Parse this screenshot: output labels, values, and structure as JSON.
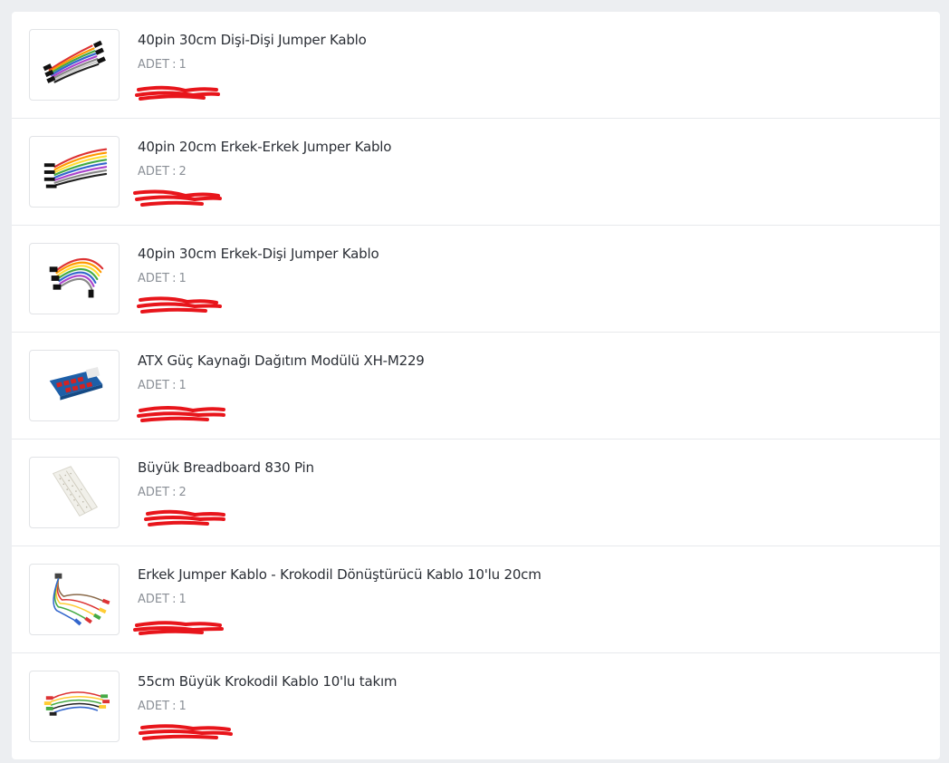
{
  "cart": {
    "qty_label": "ADET",
    "qty_separator": ":",
    "items": [
      {
        "name": "40pin 30cm Dişi-Dişi Jumper Kablo",
        "qty": "1",
        "image_icon": "jumper-wires-female-female-icon"
      },
      {
        "name": "40pin 20cm Erkek-Erkek Jumper Kablo",
        "qty": "2",
        "image_icon": "jumper-wires-male-male-icon"
      },
      {
        "name": "40pin 30cm Erkek-Dişi Jumper Kablo",
        "qty": "1",
        "image_icon": "jumper-wires-male-female-icon"
      },
      {
        "name": "ATX Güç Kaynağı Dağıtım Modülü XH-M229",
        "qty": "1",
        "image_icon": "atx-power-module-icon"
      },
      {
        "name": "Büyük Breadboard 830 Pin",
        "qty": "2",
        "image_icon": "breadboard-icon"
      },
      {
        "name": "Erkek Jumper Kablo - Krokodil Dönüştürücü Kablo 10'lu 20cm",
        "qty": "1",
        "image_icon": "crocodile-adapter-cable-icon"
      },
      {
        "name": "55cm Büyük Krokodil Kablo 10'lu takım",
        "qty": "1",
        "image_icon": "crocodile-cable-set-icon"
      }
    ]
  },
  "colors": {
    "page_bg": "#eceef1",
    "panel_bg": "#ffffff",
    "title": "#2b2f36",
    "qty": "#8b9097",
    "price_redaction": "#e8151b"
  }
}
